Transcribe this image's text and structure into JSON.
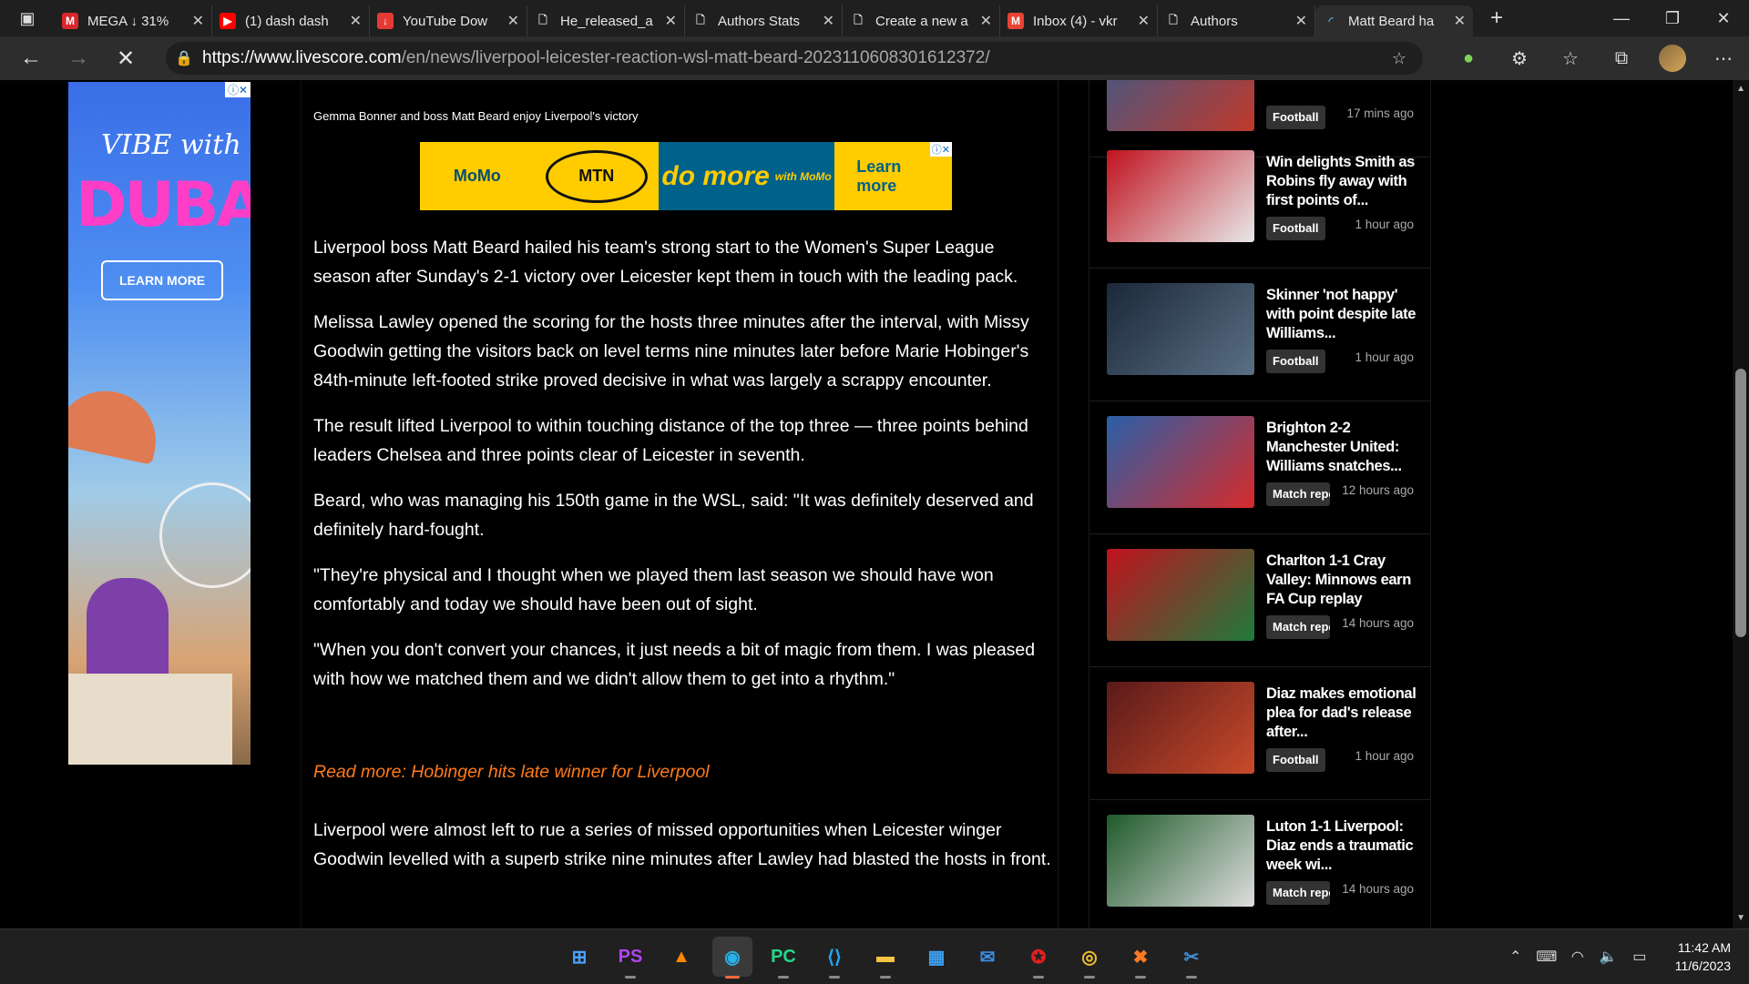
{
  "browser": {
    "tabs": [
      {
        "label": "MEGA ↓ 31%",
        "icon": "mega-icon",
        "color": "#d9272e",
        "glyph": "M"
      },
      {
        "label": "(1) dash dash",
        "icon": "youtube-icon",
        "color": "#ff0000",
        "glyph": "▶"
      },
      {
        "label": "YouTube Dow",
        "icon": "download-icon",
        "color": "#e53935",
        "glyph": "↓"
      },
      {
        "label": "He_released_a",
        "icon": "document-icon",
        "color": "",
        "glyph": "🗋"
      },
      {
        "label": "Authors Stats",
        "icon": "document-icon",
        "color": "",
        "glyph": "🗋"
      },
      {
        "label": "Create a new a",
        "icon": "document-icon",
        "color": "",
        "glyph": "🗋"
      },
      {
        "label": "Inbox (4) - vkr",
        "icon": "gmail-icon",
        "color": "#ea4335",
        "glyph": "M"
      },
      {
        "label": "Authors",
        "icon": "document-icon",
        "color": "",
        "glyph": "🗋"
      },
      {
        "label": "Matt Beard ha",
        "icon": "loading-icon",
        "color": "#4aa3df",
        "glyph": "◜",
        "active": true
      }
    ],
    "url_host": "https://www.livescore.com",
    "url_path": "/en/news/liverpool-leicester-reaction-wsl-matt-beard-20231106083016123​72/"
  },
  "ads": {
    "left": {
      "line1": "VIBE with",
      "line2": "DUBAI",
      "button": "LEARN MORE"
    },
    "banner": {
      "brand": "MoMo",
      "mtn": "MTN",
      "slogan": "do more",
      "sub": "with MoMo",
      "button": "Learn more"
    }
  },
  "article": {
    "caption": "Gemma Bonner and boss Matt Beard enjoy Liverpool's victory",
    "paragraphs": [
      "Liverpool boss Matt Beard hailed his team's strong start to the Women's Super League season after Sunday's 2-1 victory over Leicester kept them in touch with the leading pack.",
      "Melissa Lawley opened the scoring for the hosts three minutes after the interval, with Missy Goodwin getting the visitors back on level terms nine minutes later before Marie Hobinger's 84th-minute left-footed strike proved decisive in what was largely a scrappy encounter.",
      "The result lifted Liverpool to within touching distance of the top three — three points behind leaders Chelsea and three points clear of Leicester in seventh.",
      "Beard, who was managing his 150th game in the WSL, said: \"It was definitely deserved and definitely hard-fought.",
      "\"They're physical and I thought when we played them last season we should have won comfortably and today we should have been out of sight.",
      "\"When you don't convert your chances, it just needs a bit of magic from them. I was pleased with how we matched them and we didn't allow them to get into a rhythm.\""
    ],
    "read_more": "Read more: Hobinger hits late winner for Liverpool",
    "last_paragraph": " Liverpool were almost left to rue a series of missed opportunities when Leicester winger Goodwin levelled with a superb strike nine minutes after Lawley had blasted the hosts in front."
  },
  "sidebar": {
    "items": [
      {
        "title": "",
        "tag": "Football",
        "time": "17 mins ago",
        "colors": [
          "#3a5a8a",
          "#c0392b"
        ]
      },
      {
        "title": "Win delights Smith as Robins fly away with first points of...",
        "tag": "Football",
        "time": "1 hour ago",
        "colors": [
          "#c0121f",
          "#e8e8e8"
        ]
      },
      {
        "title": "Skinner 'not happy' with point despite late Williams...",
        "tag": "Football",
        "time": "1 hour ago",
        "colors": [
          "#1b2838",
          "#5a6f85"
        ]
      },
      {
        "title": "Brighton 2-2 Manchester United: Williams snatches...",
        "tag": "Match reports",
        "time": "12 hours ago",
        "colors": [
          "#2a5fa8",
          "#d62b2b"
        ]
      },
      {
        "title": "Charlton 1-1 Cray Valley: Minnows earn FA Cup replay",
        "tag": "Match reports",
        "time": "14 hours ago",
        "colors": [
          "#c0121f",
          "#1f7a3a"
        ]
      },
      {
        "title": "Diaz makes emotional plea for dad's release after...",
        "tag": "Football",
        "time": "1 hour ago",
        "colors": [
          "#5a1a1a",
          "#c84a2a"
        ]
      },
      {
        "title": "Luton 1-1 Liverpool: Diaz ends a traumatic week wi...",
        "tag": "Match reports",
        "time": "14 hours ago",
        "colors": [
          "#1f5a2a",
          "#dddddd"
        ]
      }
    ]
  },
  "taskbar": {
    "apps": [
      {
        "name": "windows-start-icon",
        "glyph": "⊞",
        "color": "#4aa3ff"
      },
      {
        "name": "phpstorm-icon",
        "glyph": "PS",
        "color": "#b345f1"
      },
      {
        "name": "vlc-icon",
        "glyph": "▲",
        "color": "#ff8800"
      },
      {
        "name": "edge-icon",
        "glyph": "◉",
        "color": "#2bb0e8",
        "active": true
      },
      {
        "name": "pycharm-icon",
        "glyph": "PC",
        "color": "#21d789"
      },
      {
        "name": "vscode-icon",
        "glyph": "⟨⟩",
        "color": "#23a9f2"
      },
      {
        "name": "file-explorer-icon",
        "glyph": "▬",
        "color": "#f4c542"
      },
      {
        "name": "microsoft-store-icon",
        "glyph": "▦",
        "color": "#3fa0f0"
      },
      {
        "name": "mail-icon",
        "glyph": "✉",
        "color": "#3a8ee8"
      },
      {
        "name": "shield-app-icon",
        "glyph": "✪",
        "color": "#e02020"
      },
      {
        "name": "chrome-canary-icon",
        "glyph": "◎",
        "color": "#f0c030"
      },
      {
        "name": "xampp-icon",
        "glyph": "✖",
        "color": "#fb7a24"
      },
      {
        "name": "snipping-tool-icon",
        "glyph": "✂",
        "color": "#3d8fd8"
      }
    ],
    "time": "11:42 AM",
    "date": "11/6/2023"
  }
}
